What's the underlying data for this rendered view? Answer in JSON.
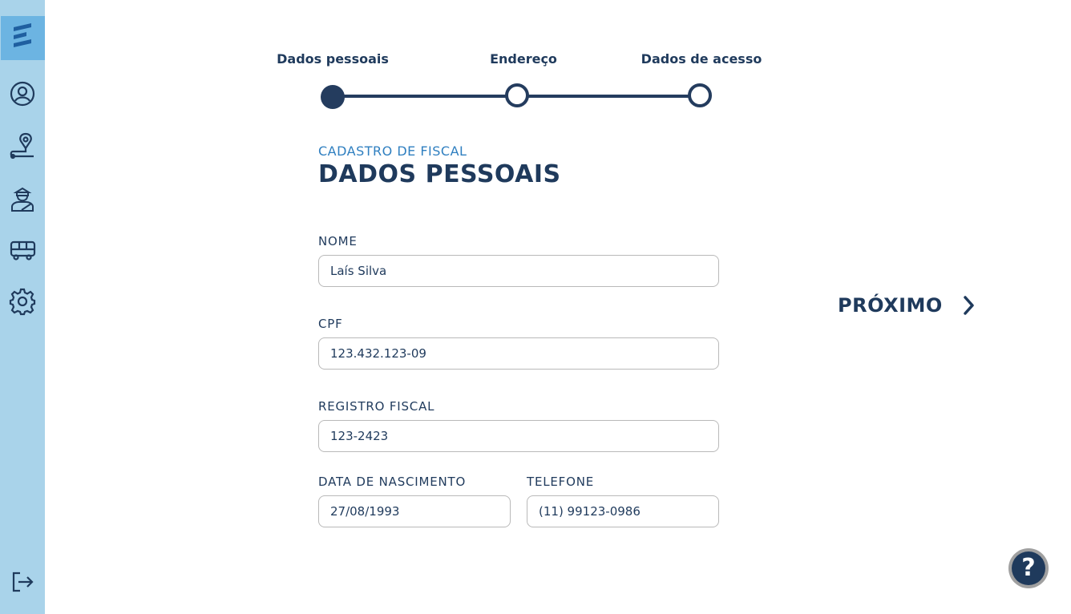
{
  "sidebar": {
    "logo": "app-logo",
    "items": [
      {
        "icon": "user-circle-icon"
      },
      {
        "icon": "location-pin-icon"
      },
      {
        "icon": "inspector-icon"
      },
      {
        "icon": "bus-icon"
      },
      {
        "icon": "gear-icon"
      }
    ],
    "logout_icon": "logout-icon",
    "colors": {
      "background": "#a9d3ea",
      "logo_background": "#6cb4e2"
    }
  },
  "stepper": {
    "steps": [
      {
        "label": "Dados pessoais",
        "state": "active"
      },
      {
        "label": "Endereço",
        "state": "pending"
      },
      {
        "label": "Dados de acesso",
        "state": "pending"
      }
    ]
  },
  "header": {
    "subtitle": "CADASTRO DE FISCAL",
    "title": "DADOS PESSOAIS"
  },
  "form": {
    "nome": {
      "label": "NOME",
      "value": "Laís Silva"
    },
    "cpf": {
      "label": "CPF",
      "value": "123.432.123-09"
    },
    "registro_fiscal": {
      "label": "REGISTRO FISCAL",
      "value": "123-2423"
    },
    "data_nascimento": {
      "label": "DATA DE NASCIMENTO",
      "value": "27/08/1993"
    },
    "telefone": {
      "label": "TELEFONE",
      "value": "(11) 99123-0986"
    }
  },
  "actions": {
    "next_label": "PRÓXIMO",
    "next_icon": "chevron-right-icon",
    "help_label": "?"
  },
  "colors": {
    "primary": "#1f3a5c",
    "accent": "#2f7fc0",
    "input_border": "#b9b9b9"
  }
}
